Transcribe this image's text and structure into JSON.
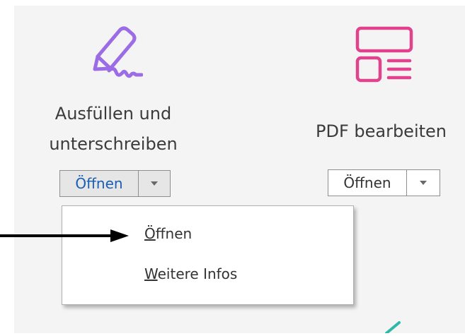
{
  "tools": [
    {
      "icon": "fill-sign-pen-icon",
      "label_line1": "Ausfüllen und",
      "label_line2": "unterschreiben",
      "open_label": "Öffnen",
      "accent": "#9c6be6"
    },
    {
      "icon": "edit-pdf-layout-icon",
      "label": "PDF bearbeiten",
      "open_label": "Öffnen",
      "accent": "#e0428e"
    }
  ],
  "dropdown_menu": {
    "items": [
      {
        "mnemonic": "Ö",
        "rest": "ffnen"
      },
      {
        "mnemonic": "W",
        "rest": "eitere Infos"
      }
    ]
  },
  "annotation": {
    "icon": "arrow-right-icon",
    "color": "#000000"
  },
  "colors": {
    "panel_background": "#f4f4f4",
    "active_button_text": "#1a5eb4",
    "partial_icon": "#2fb8a8"
  }
}
